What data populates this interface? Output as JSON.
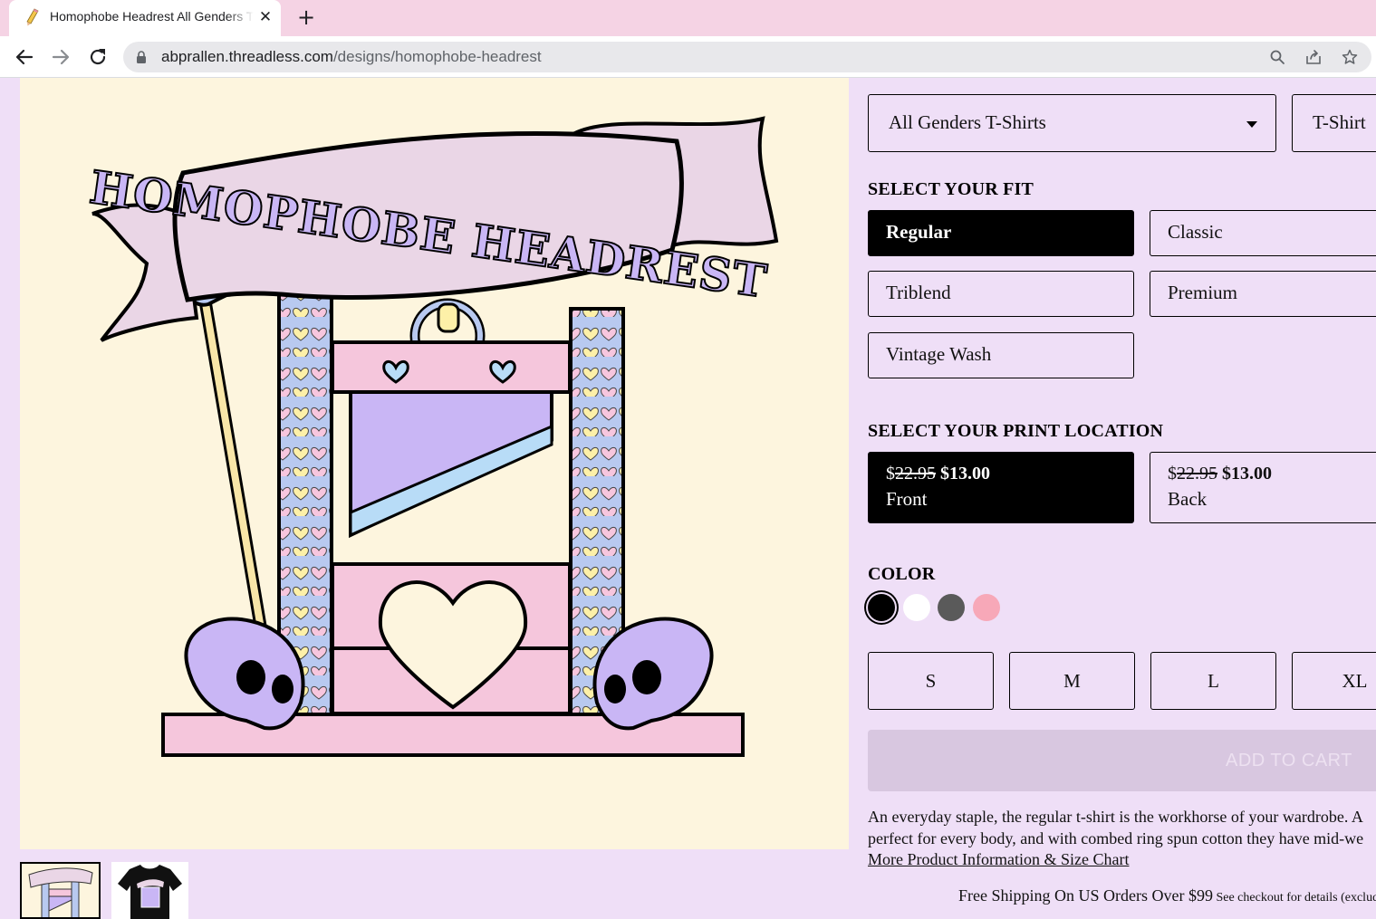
{
  "browser": {
    "tab_title": "Homophobe Headrest All Genders T-Shirt",
    "url_host": "abprallen.threadless.com",
    "url_path": "/designs/homophobe-headrest"
  },
  "product": {
    "style_select": "All Genders T-Shirts",
    "type_select": "T-Shirt",
    "fit_heading": "SELECT YOUR FIT",
    "fits": [
      "Regular",
      "Classic",
      "Triblend",
      "Premium",
      "Vintage Wash"
    ],
    "selected_fit": "Regular",
    "print_heading": "SELECT YOUR PRINT LOCATION",
    "print_locations": [
      {
        "currency": "$",
        "old_price": "22.95",
        "new_price": "$13.00",
        "label": "Front",
        "selected": true
      },
      {
        "currency": "$",
        "old_price": "22.95",
        "new_price": "$13.00",
        "label": "Back",
        "selected": false
      }
    ],
    "color_heading": "COLOR",
    "colors": [
      "#000000",
      "#ffffff",
      "#5a5a5a",
      "#f7a8b8"
    ],
    "sizes": [
      "S",
      "M",
      "L",
      "XL"
    ],
    "add_to_cart": "ADD TO CART",
    "description_line1": "An everyday staple, the regular t-shirt is the workhorse of your wardrobe. A",
    "description_line2": "perfect for every body, and with combed ring spun cotton they have mid-we",
    "more_info_link": "More Product Information & Size Chart",
    "shipping_main": "Free Shipping On US Orders Over $99",
    "shipping_note": " See checkout for details (exclud"
  },
  "artwork": {
    "banner_text": "HOMOPHOBE HEADREST"
  }
}
